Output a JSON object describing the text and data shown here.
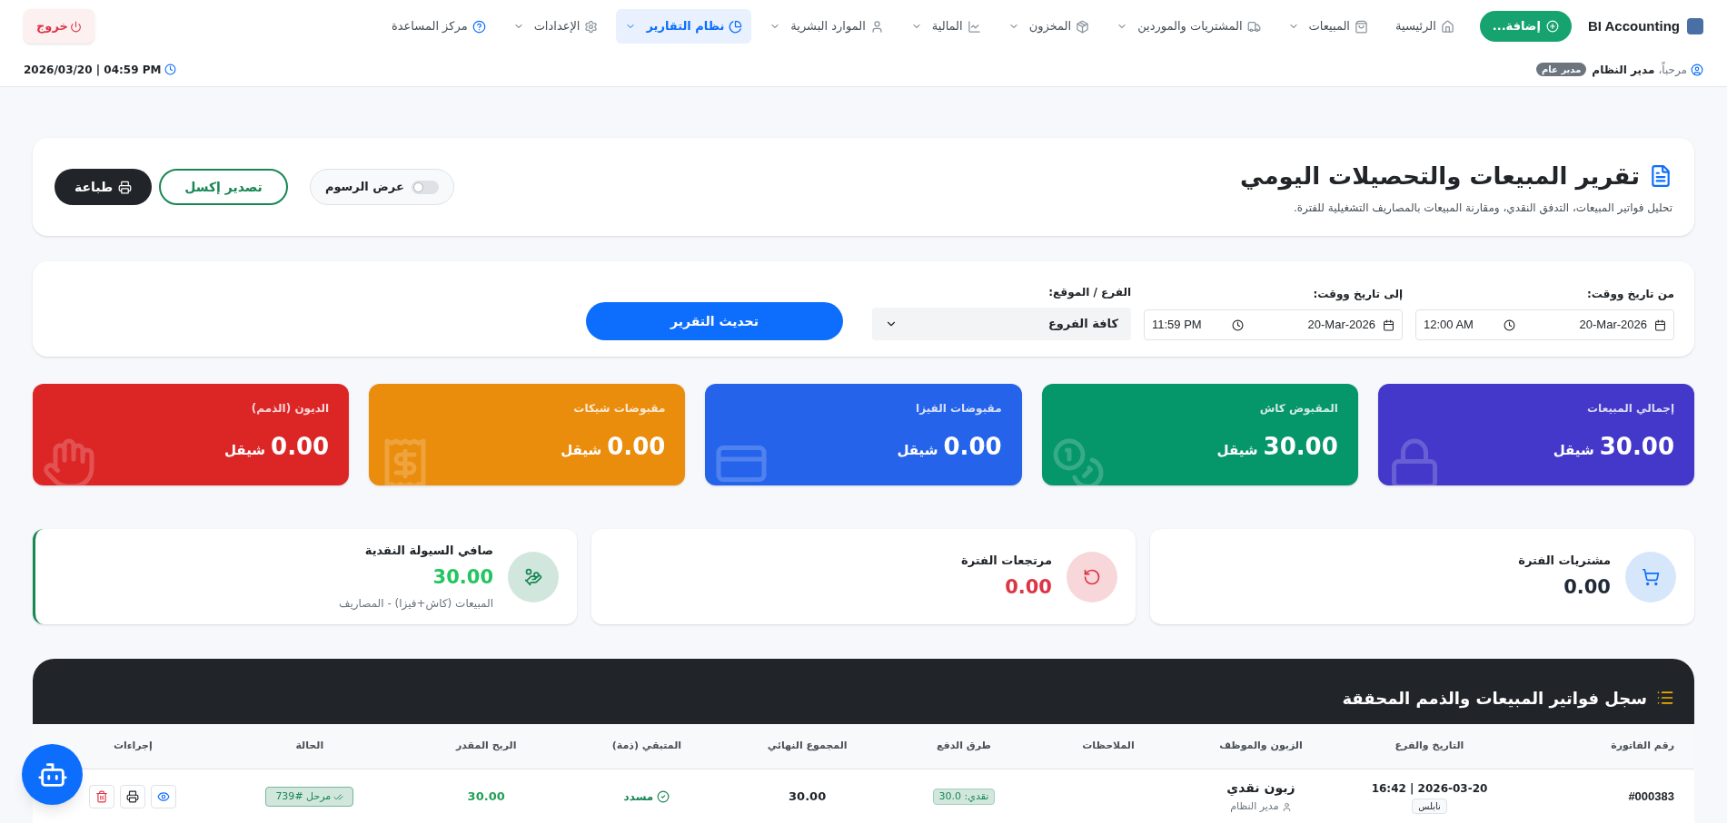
{
  "nav": {
    "brand": "BI Accounting",
    "add_button": "إضافة...",
    "items": [
      {
        "label": "الرئيسية",
        "dropdown": false,
        "selected": false
      },
      {
        "label": "المبيعات",
        "dropdown": true,
        "selected": false
      },
      {
        "label": "المشتريات والموردين",
        "dropdown": true,
        "selected": false
      },
      {
        "label": "المخزون",
        "dropdown": true,
        "selected": false
      },
      {
        "label": "المالية",
        "dropdown": true,
        "selected": false
      },
      {
        "label": "الموارد البشرية",
        "dropdown": true,
        "selected": false
      },
      {
        "label": "نظام التقارير",
        "dropdown": true,
        "selected": true
      },
      {
        "label": "الإعدادات",
        "dropdown": true,
        "selected": false
      },
      {
        "label": "مركز المساعدة",
        "dropdown": false,
        "selected": false
      }
    ],
    "logout": "خروج"
  },
  "user_bar": {
    "greeting": "مرحباً،",
    "user": "مدير النظام",
    "role": "مدير عام",
    "datetime": "2026/03/20 | 04:59 PM"
  },
  "header": {
    "title": "تقرير المبيعات والتحصيلات اليومي",
    "subtitle": "تحليل فواتير المبيعات، التدفق النقدي، ومقارنة المبيعات بالمصاريف التشغيلية للفترة.",
    "charts_toggle": {
      "label": "عرض الرسوم",
      "on": false
    },
    "export_button": "تصدير إكسل",
    "print_button": "طباعة"
  },
  "filters": {
    "from": {
      "label": "من تاريخ ووقت:",
      "date": "20-Mar-2026",
      "time": "12:00 AM"
    },
    "to": {
      "label": "إلى تاريخ ووقت:",
      "date": "20-Mar-2026",
      "time": "11:59 PM"
    },
    "branch": {
      "label": "الفرع / الموقع:",
      "value": "كافة الفروع"
    },
    "update_button": "تحديث التقرير"
  },
  "stat_cards": [
    {
      "label": "إجمالي المبيعات",
      "value": "30.00",
      "currency": "شيقل",
      "color": "#4338ca"
    },
    {
      "label": "المقبوض كاش",
      "value": "30.00",
      "currency": "شيقل",
      "color": "#059669"
    },
    {
      "label": "مقبوضات الفيزا",
      "value": "0.00",
      "currency": "شيقل",
      "color": "#2563eb"
    },
    {
      "label": "مقبوضات شيكات",
      "value": "0.00",
      "currency": "شيقل",
      "color": "#ea8c0c"
    },
    {
      "label": "الديون (الذمم)",
      "value": "0.00",
      "currency": "شيقل",
      "color": "#dc2626"
    }
  ],
  "summary_cards": [
    {
      "label": "مشتريات الفترة",
      "value": "0.00",
      "color": "#1f2937"
    },
    {
      "label": "مرتجعات الفترة",
      "value": "0.00",
      "color": "#dc3545"
    },
    {
      "label": "صافي السيولة النقدية",
      "value": "30.00",
      "note": "المبيعات (كاش+فيزا) - المصاريف",
      "color": "#22c55e"
    }
  ],
  "invoices": {
    "title": "سجل فواتير المبيعات والذمم المحققة",
    "columns": [
      "رقم الفاتورة",
      "التاريخ والفرع",
      "الزبون والموظف",
      "الملاحظات",
      "طرق الدفع",
      "المجموع النهائي",
      "المتبقي (ذمة)",
      "الربح المقدر",
      "الحالة",
      "إجراءات"
    ],
    "rows": [
      {
        "number": "#000383",
        "datetime": "2026-03-20 | 16:42",
        "branch": "نابلس",
        "customer": "زبون نقدي",
        "employee": "مدير النظام",
        "payment": "نقدي: 30.0",
        "total": "30.00",
        "remaining": "مسدد",
        "paid": true,
        "profit": "30.00",
        "status": "مرحل #739"
      }
    ]
  }
}
